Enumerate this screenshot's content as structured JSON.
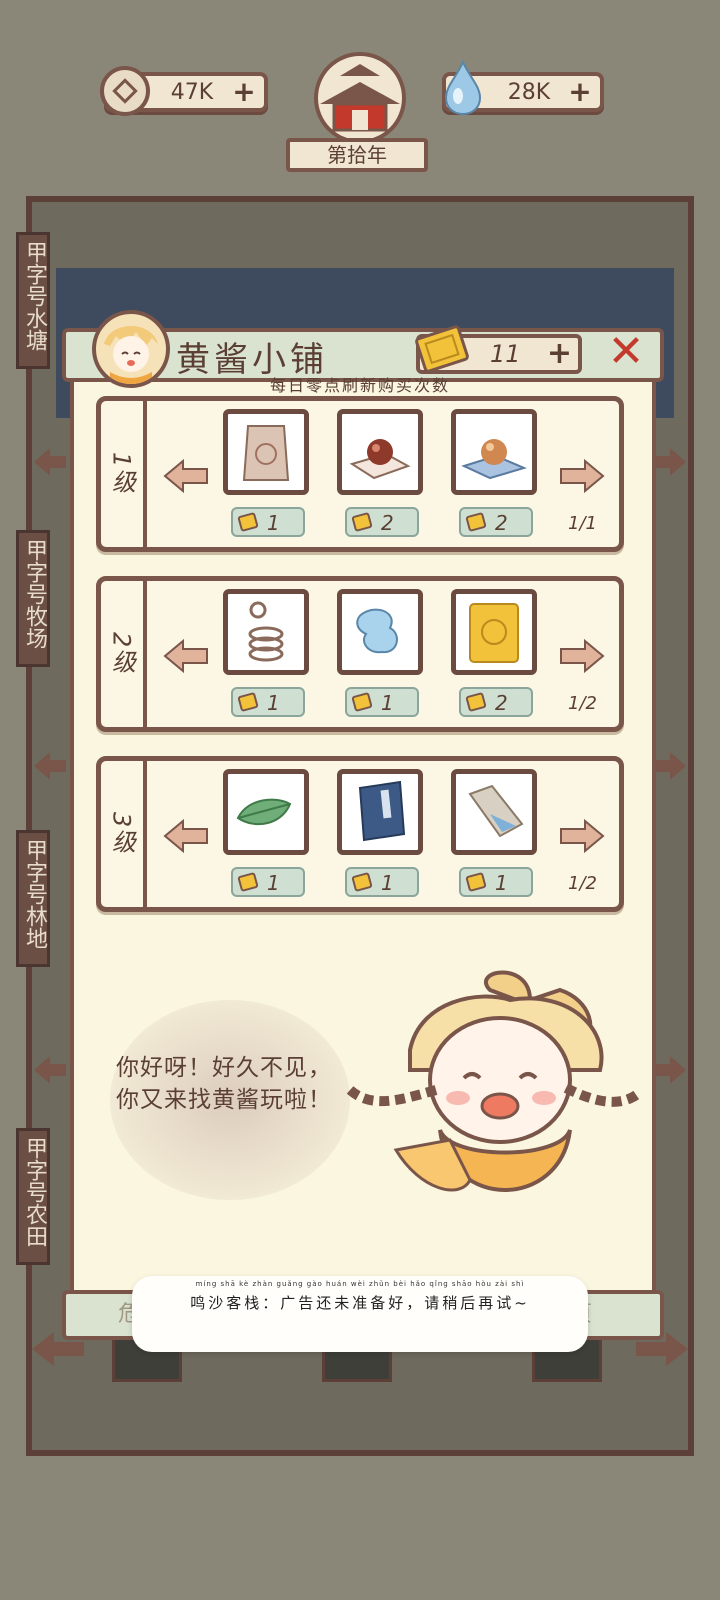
{
  "top_bar": {
    "coins": "47K",
    "gems": "28K",
    "year": "第拾年"
  },
  "sidebar": {
    "tabs": [
      "甲字号水塘",
      "甲字号牧场",
      "甲字号林地",
      "甲字号农田"
    ]
  },
  "shop": {
    "title": "黄酱小铺",
    "ticket_count": "11",
    "subtitle": "每日零点刷新购买次数",
    "tiers": [
      {
        "label": "1级",
        "stock": "1/1",
        "items": [
          {
            "icon": "paper-bag-icon",
            "price": "1"
          },
          {
            "icon": "red-pill-icon",
            "price": "2"
          },
          {
            "icon": "orange-pearl-icon",
            "price": "2"
          }
        ]
      },
      {
        "label": "2级",
        "stock": "1/2",
        "items": [
          {
            "icon": "rope-coil-icon",
            "price": "1"
          },
          {
            "icon": "blue-spirit-icon",
            "price": "1"
          },
          {
            "icon": "golden-talisman-icon",
            "price": "2"
          }
        ]
      },
      {
        "label": "3级",
        "stock": "1/2",
        "items": [
          {
            "icon": "green-leaf-icon",
            "price": "1"
          },
          {
            "icon": "blue-book-icon",
            "price": "1"
          },
          {
            "icon": "stone-tablet-icon",
            "price": "1"
          }
        ]
      }
    ]
  },
  "dialogue": {
    "text": "你好呀！好久不见，你又来找黄酱玩啦！"
  },
  "toast": {
    "pinyin": "míng shā kè zhàn   guǎng gào huán wèi zhǔn bèi hǎo   qǐng shāo hòu zài shì",
    "text": "鸣沙客栈：广告还未准备好，请稍后再试~"
  },
  "colors": {
    "frame": "#7a5549",
    "panel": "#faf6df",
    "close": "#c33a2c",
    "price_tag": "#cfe0d2"
  }
}
